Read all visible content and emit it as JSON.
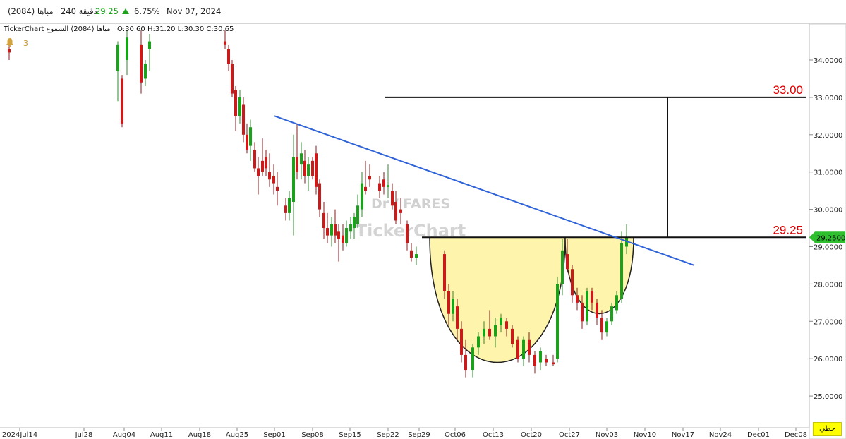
{
  "header": {
    "symbol": "مباها (2084)",
    "interval": "240 دقيقة",
    "price": "29.25",
    "change_pct": "6.75%",
    "date": "Nov 07, 2024"
  },
  "legend": {
    "source": "TickerChart",
    "name": "مباها (2084)",
    "type_label": "الشموع",
    "open": "O:30.60",
    "high": "H:31.20",
    "low": "L:30.30",
    "close": "C:30.65"
  },
  "alerts": {
    "count": "3"
  },
  "price_tag": "29.2500",
  "line_button": "خطي",
  "watermark": {
    "line1": "Dr / FARES",
    "line2": "TickerChart"
  },
  "colors": {
    "up": "#1aa31a",
    "down": "#cc1a1a",
    "trend": "#2f63d8",
    "cup_fill": "#fff3a6",
    "level_text": "#dd0000",
    "price_tag_bg": "#2fbf2f",
    "line_button_bg": "#ffff00"
  },
  "chart_data": {
    "type": "candlestick",
    "y_range": [
      24.3,
      35.0
    ],
    "y_ticks": [
      "34.0000",
      "33.0000",
      "32.0000",
      "31.0000",
      "30.0000",
      "29.0000",
      "28.0000",
      "27.0000",
      "26.0000",
      "25.0000"
    ],
    "x_ticks": [
      "2024Jul14",
      "Jul28",
      "Aug04",
      "Aug11",
      "Aug18",
      "Aug25",
      "Sep01",
      "Sep08",
      "Sep15",
      "Sep22",
      "Sep29",
      "Oct06",
      "Oct13",
      "Oct20",
      "Oct27",
      "Nov03",
      "Nov10",
      "Nov17",
      "Nov24",
      "Dec01",
      "Dec08"
    ],
    "levels": [
      {
        "label": "33.00",
        "value": 33.0
      },
      {
        "label": "29.25",
        "value": 29.25
      }
    ],
    "trendline": {
      "from": [
        "Sep06",
        32.5
      ],
      "to": [
        "Nov18",
        28.5
      ]
    },
    "patterns": [
      {
        "type": "cup",
        "from": "Sep29",
        "to": "Oct27",
        "rim": 29.25,
        "bottom": 25.35
      },
      {
        "type": "handle",
        "from": "Oct27",
        "to": "Nov06",
        "rim": 29.25,
        "bottom": 26.75
      }
    ],
    "candles": [
      {
        "x": "Jul14",
        "o": 34.3,
        "h": 34.5,
        "l": 34.0,
        "c": 34.2
      },
      {
        "x": "Aug03a",
        "o": 33.7,
        "h": 34.5,
        "l": 32.9,
        "c": 34.4
      },
      {
        "x": "Aug03b",
        "o": 33.5,
        "h": 33.6,
        "l": 32.2,
        "c": 32.3
      },
      {
        "x": "Aug04",
        "o": 34.0,
        "h": 34.8,
        "l": 33.6,
        "c": 34.6
      },
      {
        "x": "Aug08a",
        "o": 34.4,
        "h": 34.8,
        "l": 33.1,
        "c": 33.4
      },
      {
        "x": "Aug08b",
        "o": 33.5,
        "h": 34.0,
        "l": 33.3,
        "c": 33.9
      },
      {
        "x": "Aug11",
        "o": 34.3,
        "h": 34.7,
        "l": 33.7,
        "c": 34.5
      },
      {
        "x": "Aug25a",
        "o": 34.5,
        "h": 34.8,
        "l": 34.3,
        "c": 34.4
      },
      {
        "x": "Aug25b",
        "o": 34.3,
        "h": 34.4,
        "l": 33.7,
        "c": 33.9
      },
      {
        "x": "Aug26",
        "o": 33.9,
        "h": 34.0,
        "l": 33.0,
        "c": 33.1
      },
      {
        "x": "Aug27",
        "o": 33.2,
        "h": 33.3,
        "l": 32.1,
        "c": 32.5
      },
      {
        "x": "Aug28",
        "o": 32.5,
        "h": 33.2,
        "l": 32.3,
        "c": 33.0
      },
      {
        "x": "Aug29",
        "o": 32.8,
        "h": 33.0,
        "l": 31.8,
        "c": 32.0
      },
      {
        "x": "Aug30",
        "o": 32.0,
        "h": 32.3,
        "l": 31.5,
        "c": 31.6
      },
      {
        "x": "Aug31",
        "o": 31.7,
        "h": 32.4,
        "l": 31.3,
        "c": 32.2
      },
      {
        "x": "Sep01",
        "o": 31.6,
        "h": 31.8,
        "l": 31.0,
        "c": 31.1
      },
      {
        "x": "Sep02",
        "o": 31.1,
        "h": 31.4,
        "l": 30.4,
        "c": 30.9
      },
      {
        "x": "Sep03",
        "o": 31.3,
        "h": 31.9,
        "l": 30.9,
        "c": 31.0
      },
      {
        "x": "Sep04",
        "o": 31.4,
        "h": 31.6,
        "l": 30.9,
        "c": 31.1
      },
      {
        "x": "Sep05",
        "o": 31.0,
        "h": 31.5,
        "l": 30.6,
        "c": 30.8
      },
      {
        "x": "Sep06",
        "o": 30.9,
        "h": 31.2,
        "l": 30.4,
        "c": 30.7
      },
      {
        "x": "Sep07",
        "o": 30.6,
        "h": 31.0,
        "l": 30.1,
        "c": 30.5
      },
      {
        "x": "Sep08a",
        "o": 30.1,
        "h": 30.3,
        "l": 29.7,
        "c": 29.9
      },
      {
        "x": "Sep08b",
        "o": 29.9,
        "h": 30.5,
        "l": 29.7,
        "c": 30.3
      },
      {
        "x": "Sep09",
        "o": 30.2,
        "h": 32.0,
        "l": 29.3,
        "c": 31.4
      },
      {
        "x": "Sep10",
        "o": 31.4,
        "h": 32.3,
        "l": 30.8,
        "c": 31.0
      },
      {
        "x": "Sep11",
        "o": 31.2,
        "h": 31.8,
        "l": 30.8,
        "c": 31.5
      },
      {
        "x": "Sep12",
        "o": 31.3,
        "h": 31.6,
        "l": 30.7,
        "c": 30.9
      },
      {
        "x": "Sep13",
        "o": 30.9,
        "h": 31.4,
        "l": 30.5,
        "c": 31.2
      },
      {
        "x": "Sep14",
        "o": 31.3,
        "h": 31.4,
        "l": 30.8,
        "c": 30.9
      },
      {
        "x": "Sep15",
        "o": 31.5,
        "h": 31.7,
        "l": 30.4,
        "c": 30.6
      },
      {
        "x": "Sep16",
        "o": 30.7,
        "h": 30.8,
        "l": 29.8,
        "c": 30.0
      },
      {
        "x": "Sep17",
        "o": 29.9,
        "h": 30.2,
        "l": 29.2,
        "c": 29.5
      },
      {
        "x": "Sep18",
        "o": 29.5,
        "h": 29.9,
        "l": 29.1,
        "c": 29.3
      },
      {
        "x": "Sep19",
        "o": 29.3,
        "h": 29.8,
        "l": 29.0,
        "c": 29.6
      },
      {
        "x": "Sep20",
        "o": 29.6,
        "h": 30.0,
        "l": 29.1,
        "c": 29.3
      },
      {
        "x": "Sep21",
        "o": 29.4,
        "h": 29.6,
        "l": 28.6,
        "c": 29.2
      },
      {
        "x": "Sep22a",
        "o": 29.3,
        "h": 29.6,
        "l": 28.9,
        "c": 29.1
      },
      {
        "x": "Sep22b",
        "o": 29.1,
        "h": 29.7,
        "l": 29.0,
        "c": 29.5
      },
      {
        "x": "Sep23",
        "o": 29.4,
        "h": 29.8,
        "l": 29.2,
        "c": 29.6
      },
      {
        "x": "Sep24",
        "o": 29.5,
        "h": 29.9,
        "l": 29.2,
        "c": 29.8
      },
      {
        "x": "Sep25",
        "o": 29.6,
        "h": 30.4,
        "l": 29.5,
        "c": 30.1
      },
      {
        "x": "Sep26",
        "o": 30.0,
        "h": 31.0,
        "l": 29.8,
        "c": 30.7
      },
      {
        "x": "Sep27",
        "o": 30.6,
        "h": 31.3,
        "l": 30.4,
        "c": 30.5
      },
      {
        "x": "Sep28",
        "o": 30.9,
        "h": 31.2,
        "l": 30.6,
        "c": 30.8
      },
      {
        "x": "Sep29",
        "o": 30.7,
        "h": 30.9,
        "l": 30.3,
        "c": 30.5
      },
      {
        "x": "Sep30",
        "o": 30.8,
        "h": 31.0,
        "l": 30.4,
        "c": 30.6
      },
      {
        "x": "Oct01a",
        "o": 30.6,
        "h": 31.2,
        "l": 30.3,
        "c": 30.65
      },
      {
        "x": "Oct01b",
        "o": 30.5,
        "h": 30.7,
        "l": 30.0,
        "c": 30.1
      },
      {
        "x": "Oct01c",
        "o": 30.2,
        "h": 30.5,
        "l": 29.6,
        "c": 29.7
      },
      {
        "x": "Oct02",
        "o": 30.0,
        "h": 30.3,
        "l": 29.6,
        "c": 29.9
      },
      {
        "x": "Oct03",
        "o": 29.6,
        "h": 29.7,
        "l": 28.9,
        "c": 29.1
      },
      {
        "x": "Oct04",
        "o": 28.9,
        "h": 29.1,
        "l": 28.6,
        "c": 28.7
      },
      {
        "x": "Oct05",
        "o": 28.7,
        "h": 29.0,
        "l": 28.5,
        "c": 28.8
      },
      {
        "x": "Oct06",
        "o": 28.8,
        "h": 28.9,
        "l": 27.6,
        "c": 27.8
      },
      {
        "x": "Oct07",
        "o": 27.8,
        "h": 28.0,
        "l": 26.9,
        "c": 27.2
      },
      {
        "x": "Oct08",
        "o": 27.2,
        "h": 27.8,
        "l": 27.0,
        "c": 27.6
      },
      {
        "x": "Oct09",
        "o": 27.4,
        "h": 27.6,
        "l": 26.5,
        "c": 26.8
      },
      {
        "x": "Oct10",
        "o": 26.8,
        "h": 27.0,
        "l": 25.9,
        "c": 26.1
      },
      {
        "x": "Oct11",
        "o": 26.1,
        "h": 26.5,
        "l": 25.5,
        "c": 25.7
      },
      {
        "x": "Oct12",
        "o": 25.7,
        "h": 26.4,
        "l": 25.5,
        "c": 26.3
      },
      {
        "x": "Oct13",
        "o": 26.3,
        "h": 26.7,
        "l": 26.1,
        "c": 26.6
      },
      {
        "x": "Oct14",
        "o": 26.6,
        "h": 27.0,
        "l": 26.4,
        "c": 26.8
      },
      {
        "x": "Oct15",
        "o": 26.8,
        "h": 27.3,
        "l": 26.5,
        "c": 26.6
      },
      {
        "x": "Oct16",
        "o": 26.6,
        "h": 27.1,
        "l": 26.3,
        "c": 26.9
      },
      {
        "x": "Oct17",
        "o": 26.9,
        "h": 27.2,
        "l": 26.7,
        "c": 27.1
      },
      {
        "x": "Oct18",
        "o": 27.0,
        "h": 27.1,
        "l": 26.6,
        "c": 26.8
      },
      {
        "x": "Oct19",
        "o": 26.8,
        "h": 26.9,
        "l": 26.3,
        "c": 26.4
      },
      {
        "x": "Oct20",
        "o": 26.5,
        "h": 26.6,
        "l": 25.9,
        "c": 26.0
      },
      {
        "x": "Oct21",
        "o": 26.0,
        "h": 26.6,
        "l": 25.8,
        "c": 26.5
      },
      {
        "x": "Oct22",
        "o": 26.5,
        "h": 26.7,
        "l": 25.9,
        "c": 26.1
      },
      {
        "x": "Oct23",
        "o": 26.1,
        "h": 26.2,
        "l": 25.6,
        "c": 25.8
      },
      {
        "x": "Oct24",
        "o": 25.9,
        "h": 26.3,
        "l": 25.7,
        "c": 26.2
      },
      {
        "x": "Oct25",
        "o": 26.0,
        "h": 26.1,
        "l": 25.8,
        "c": 25.9
      },
      {
        "x": "Oct26",
        "o": 25.9,
        "h": 26.1,
        "l": 25.8,
        "c": 25.85
      },
      {
        "x": "Oct27a",
        "o": 26.0,
        "h": 28.2,
        "l": 25.9,
        "c": 28.0
      },
      {
        "x": "Oct27b",
        "o": 28.0,
        "h": 29.2,
        "l": 27.7,
        "c": 28.9
      },
      {
        "x": "Oct28",
        "o": 28.8,
        "h": 29.2,
        "l": 28.3,
        "c": 28.4
      },
      {
        "x": "Oct29",
        "o": 28.4,
        "h": 28.5,
        "l": 27.5,
        "c": 27.7
      },
      {
        "x": "Oct30",
        "o": 27.7,
        "h": 27.9,
        "l": 27.3,
        "c": 27.5
      },
      {
        "x": "Oct31",
        "o": 27.5,
        "h": 27.7,
        "l": 26.8,
        "c": 27.0
      },
      {
        "x": "Nov01",
        "o": 27.0,
        "h": 27.9,
        "l": 26.9,
        "c": 27.8
      },
      {
        "x": "Nov02",
        "o": 27.8,
        "h": 27.9,
        "l": 27.3,
        "c": 27.5
      },
      {
        "x": "Nov03",
        "o": 27.5,
        "h": 27.6,
        "l": 26.9,
        "c": 27.1
      },
      {
        "x": "Nov04",
        "o": 27.1,
        "h": 27.3,
        "l": 26.5,
        "c": 26.7
      },
      {
        "x": "Nov05",
        "o": 26.7,
        "h": 27.1,
        "l": 26.6,
        "c": 27.0
      },
      {
        "x": "Nov06a",
        "o": 27.0,
        "h": 27.5,
        "l": 26.9,
        "c": 27.4
      },
      {
        "x": "Nov06b",
        "o": 27.3,
        "h": 27.8,
        "l": 27.2,
        "c": 27.7
      },
      {
        "x": "Nov07a",
        "o": 27.6,
        "h": 29.4,
        "l": 27.5,
        "c": 29.1
      },
      {
        "x": "Nov07b",
        "o": 29.0,
        "h": 29.6,
        "l": 28.8,
        "c": 29.25
      }
    ]
  }
}
